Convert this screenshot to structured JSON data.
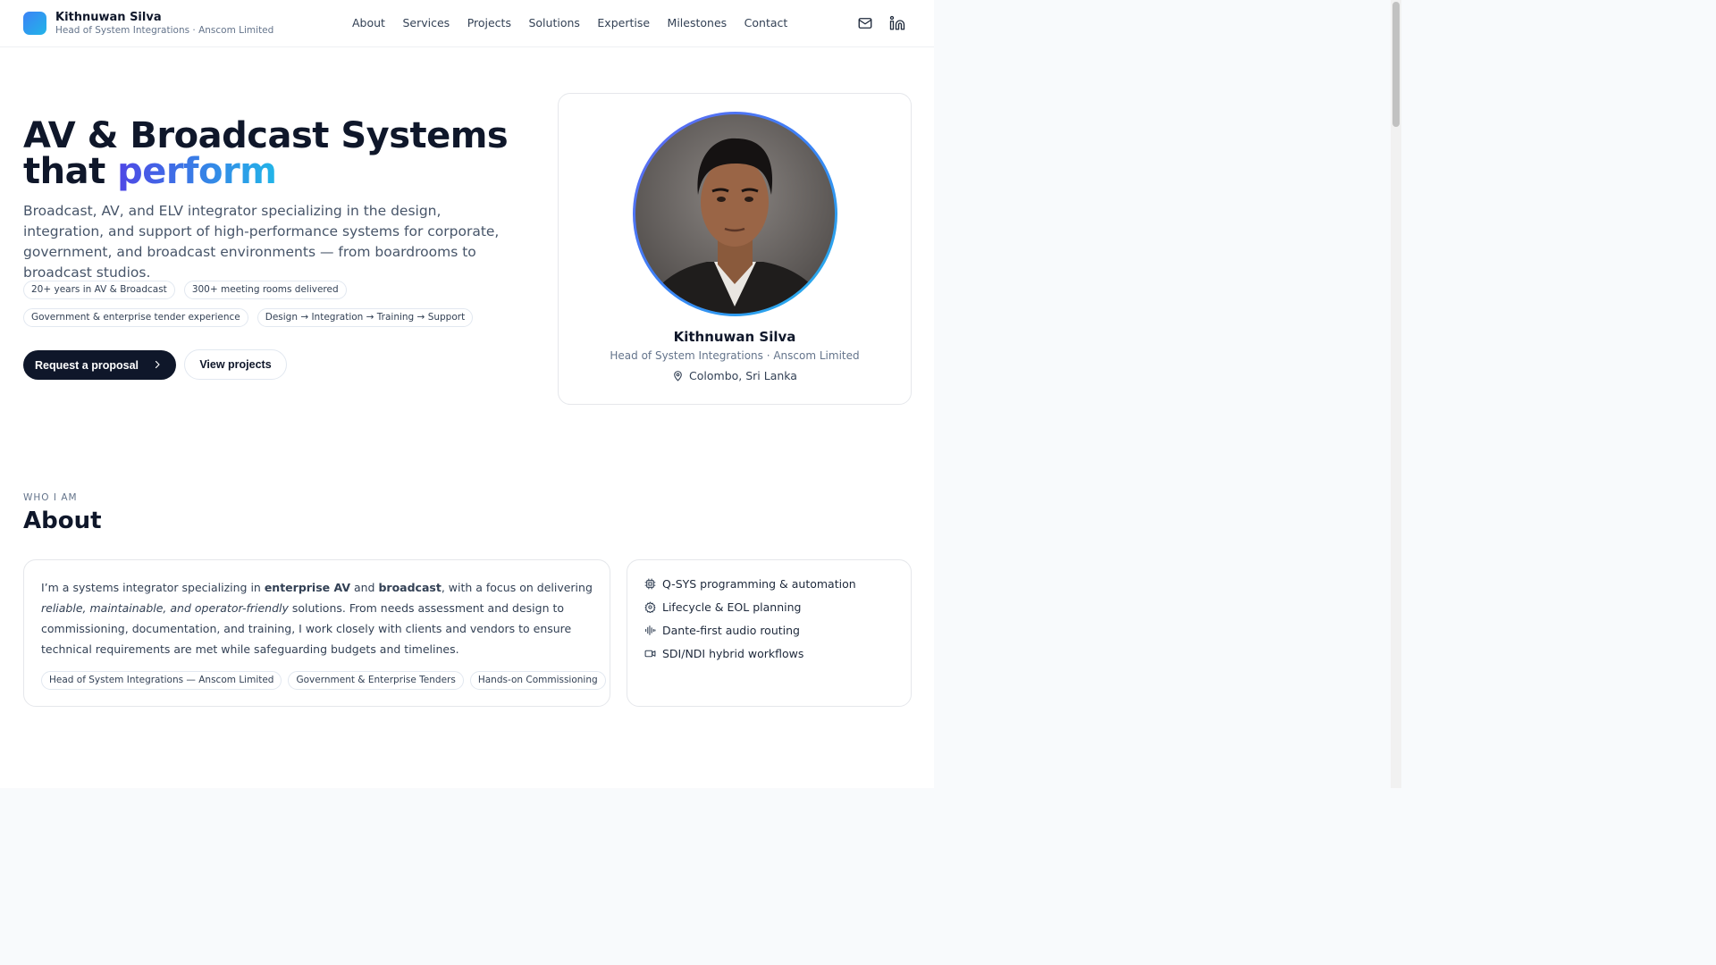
{
  "header": {
    "name": "Kithnuwan Silva",
    "subtitle": "Head of System Integrations · Anscom Limited",
    "nav": [
      "About",
      "Services",
      "Projects",
      "Solutions",
      "Expertise",
      "Milestones",
      "Contact"
    ],
    "icons": [
      "mail-icon",
      "linkedin-icon"
    ]
  },
  "hero": {
    "title_line1": "AV & Broadcast Systems",
    "title_line2_prefix": "that",
    "title_accent": "perform",
    "description": "Broadcast, AV, and ELV integrator specializing in the design, integration, and support of high-performance systems for corporate, government, and broadcast environments — from boardrooms to broadcast studios.",
    "chips_row1": [
      "20+ years in AV & Broadcast",
      "300+ meeting rooms delivered"
    ],
    "chips_row2": [
      "Government & enterprise tender experience",
      "Design → Integration → Training → Support"
    ],
    "primary_cta": "Request a proposal",
    "secondary_cta": "View projects"
  },
  "profile": {
    "name": "Kithnuwan Silva",
    "role": "Head of System Integrations · Anscom Limited",
    "location": "Colombo, Sri Lanka"
  },
  "about": {
    "eyebrow": "WHO I AM",
    "title": "About",
    "text_1": "I’m a systems integrator specializing in ",
    "bold_1": "enterprise AV",
    "text_2": " and ",
    "bold_2": "broadcast",
    "text_3": ", with a focus on delivering ",
    "italic_1": "reliable, maintainable, and operator-friendly",
    "text_4": " solutions. From needs assessment and design to commissioning, documentation, and training, I work closely with clients and vendors to ensure technical requirements are met while safeguarding budgets and timelines.",
    "chips": [
      "Head of System Integrations — Anscom Limited",
      "Government & Enterprise Tenders",
      "Hands-on Commissioning"
    ],
    "features": [
      {
        "label": "Q-SYS programming & automation",
        "icon": "chip-icon"
      },
      {
        "label": "Lifecycle & EOL planning",
        "icon": "gear-icon"
      },
      {
        "label": "Dante-first audio routing",
        "icon": "audio-wave-icon"
      },
      {
        "label": "SDI/NDI hybrid workflows",
        "icon": "video-camera-icon"
      }
    ]
  },
  "colors": {
    "dark": "#0f172a",
    "accent_start": "#4f46e5",
    "accent_end": "#22b5e8",
    "muted": "#64748b"
  }
}
